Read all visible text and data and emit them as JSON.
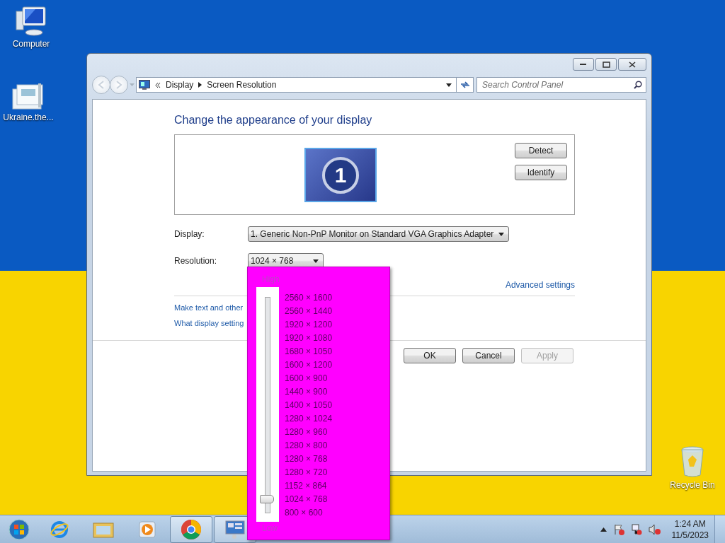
{
  "desktop_icons": [
    {
      "kind": "computer",
      "label": "Computer"
    },
    {
      "kind": "archive",
      "label": "Ukraine.the..."
    },
    {
      "kind": "recycle",
      "label": "Recycle Bin"
    }
  ],
  "window": {
    "address": {
      "path": [
        "Display",
        "Screen Resolution"
      ]
    },
    "search": {
      "placeholder": "Search Control Panel"
    },
    "heading": "Change the appearance of your display",
    "monitor_number": "1",
    "preview_buttons": [
      "Detect",
      "Identify"
    ],
    "display": {
      "label": "Display:",
      "value": "1. Generic Non-PnP Monitor on Standard VGA Graphics Adapter"
    },
    "resolution": {
      "label": "Resolution:",
      "value": "1024 × 768"
    },
    "advanced_link": "Advanced settings",
    "links": [
      "Make text and other",
      "What display setting"
    ],
    "buttons": [
      {
        "label": "OK",
        "disabled": false
      },
      {
        "label": "Cancel",
        "disabled": false
      },
      {
        "label": "Apply",
        "disabled": true
      }
    ]
  },
  "resolution_popup": {
    "high_label": "High",
    "low_label": "Low",
    "level": 0.0625,
    "options": [
      "2560 × 1600",
      "2560 × 1440",
      "1920 × 1200",
      "1920 × 1080",
      "1680 × 1050",
      "1600 × 1200",
      "1600 × 900",
      "1440 × 900",
      "1400 × 1050",
      "1280 × 1024",
      "1280 × 960",
      "1280 × 800",
      "1280 × 768",
      "1280 × 720",
      "1152 × 864",
      "1024 × 768",
      "800 × 600"
    ]
  },
  "taskbar": {
    "apps": [
      {
        "kind": "ie",
        "active": false
      },
      {
        "kind": "folder",
        "active": false
      },
      {
        "kind": "media",
        "active": false
      },
      {
        "kind": "chrome",
        "active": true
      },
      {
        "kind": "display",
        "active": true
      }
    ],
    "clock": {
      "time": "1:24 AM",
      "date": "11/5/2023"
    }
  }
}
